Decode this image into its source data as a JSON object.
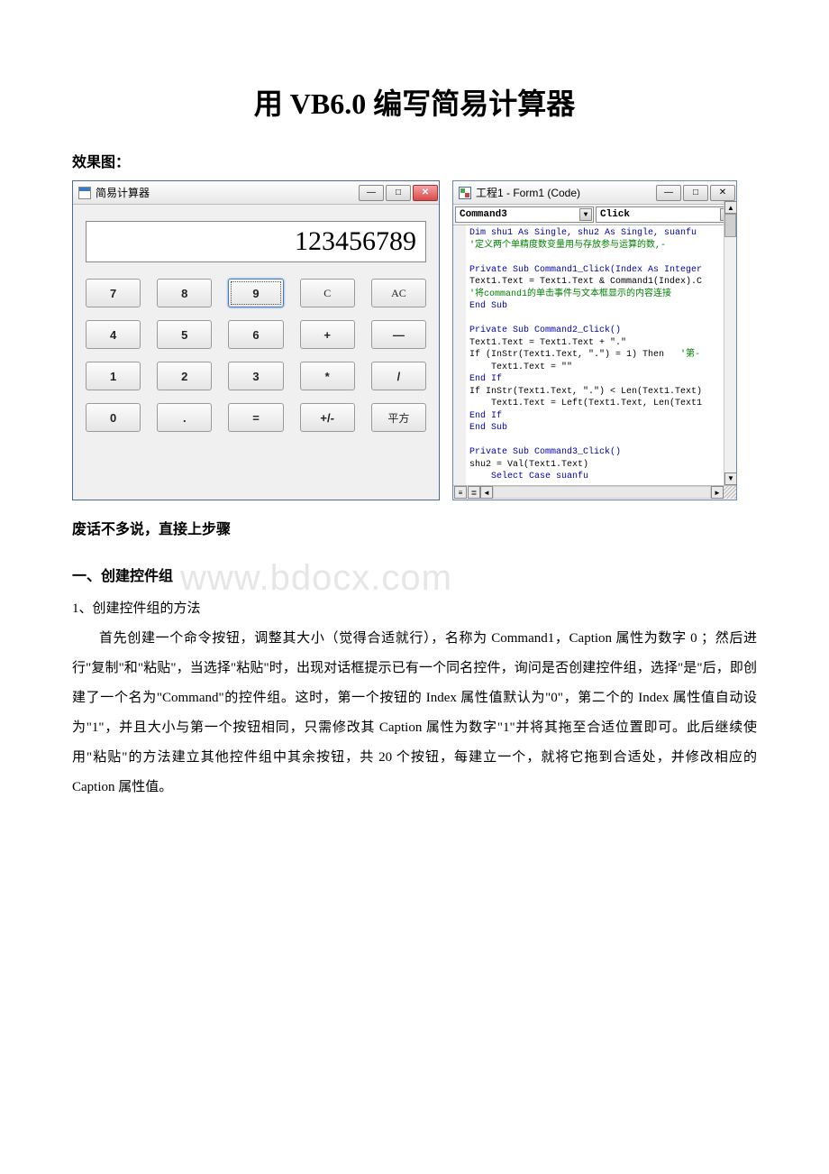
{
  "title": "用 VB6.0 编写简易计算器",
  "labels": {
    "effect": "效果图：",
    "skip": "废话不多说，直接上步骤",
    "section1": "一、创建控件组",
    "sub1": "1、创建控件组的方法"
  },
  "watermark": "www.bdocx.com",
  "calc": {
    "title": "简易计算器",
    "display": "123456789",
    "buttons": [
      [
        "7",
        "8",
        "9",
        "C",
        "AC"
      ],
      [
        "4",
        "5",
        "6",
        "+",
        "—"
      ],
      [
        "1",
        "2",
        "3",
        "*",
        "/"
      ],
      [
        "0",
        ".",
        "=",
        "+/-",
        "平方"
      ]
    ],
    "focused": {
      "row": 0,
      "col": 2
    }
  },
  "code": {
    "title": "工程1 - Form1 (Code)",
    "combo_left": "Command3",
    "combo_right": "Click",
    "lines": [
      {
        "t": "Dim shu1 As Single, shu2 As Single, suanfu",
        "cls": "kw"
      },
      {
        "t": "'定义两个单精度数变量用与存放参与运算的数,-",
        "cls": "cm"
      },
      {
        "t": ""
      },
      {
        "t": "Private Sub Command1_Click(Index As Integer",
        "cls": "kw"
      },
      {
        "t": "Text1.Text = Text1.Text & Command1(Index).C"
      },
      {
        "t": "'将command1的单击事件与文本框显示的内容连接",
        "cls": "cm"
      },
      {
        "t": "End Sub",
        "cls": "kw"
      },
      {
        "t": ""
      },
      {
        "t": "Private Sub Command2_Click()",
        "cls": "kw"
      },
      {
        "t": "Text1.Text = Text1.Text + \".\""
      },
      {
        "t": "If (InStr(Text1.Text, \".\") = 1) Then   '第-",
        "mix": [
          {
            "s": "If (InStr(Text1.Text, \".\") = 1) Then   ",
            "c": ""
          },
          {
            "s": "'第-",
            "c": "cm"
          }
        ]
      },
      {
        "t": "    Text1.Text = \"\""
      },
      {
        "t": "End If",
        "cls": "kw"
      },
      {
        "t": "If InStr(Text1.Text, \".\") < Len(Text1.Text)"
      },
      {
        "t": "    Text1.Text = Left(Text1.Text, Len(Text1"
      },
      {
        "t": "End If",
        "cls": "kw"
      },
      {
        "t": "End Sub",
        "cls": "kw"
      },
      {
        "t": ""
      },
      {
        "t": "Private Sub Command3_Click()",
        "cls": "kw"
      },
      {
        "t": "shu2 = Val(Text1.Text)"
      },
      {
        "t": "    Select Case suanfu",
        "cls": "kw"
      }
    ]
  },
  "paragraph": "首先创建一个命令按钮，调整其大小（觉得合适就行），名称为 Command1，Caption 属性为数字 0 ；然后进行\"复制\"和\"粘贴\"，当选择\"粘贴\"时，出现对话框提示已有一个同名控件，询问是否创建控件组，选择\"是\"后，即创建了一个名为\"Command\"的控件组。这时，第一个按钮的 Index 属性值默认为\"0\"，第二个的 Index 属性值自动设为\"1\"，并且大小与第一个按钮相同，只需修改其 Caption 属性为数字\"1\"并将其拖至合适位置即可。此后继续使用\"粘贴\"的方法建立其他控件组中其余按钮，共 20 个按钮，每建立一个，就将它拖到合适处，并修改相应的 Caption 属性值。"
}
